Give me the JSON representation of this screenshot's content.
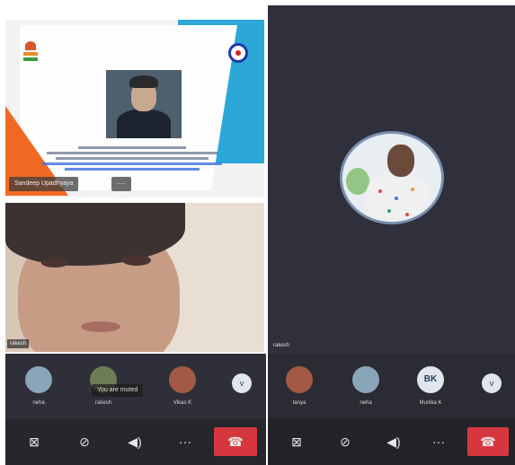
{
  "left": {
    "presenter": {
      "name": "Sandeep Upadhyaya",
      "more_label": "···"
    },
    "camera_label": "rakesh",
    "participants": [
      {
        "name": "neha"
      },
      {
        "name": "rakesh"
      },
      {
        "name": "Vikas K"
      }
    ],
    "toast": "You are muted",
    "overflow_label": "v",
    "controls": [
      "video-off",
      "mic-off",
      "speaker",
      "more",
      "hang-up"
    ]
  },
  "right": {
    "tile_label": "rakesh",
    "participants": [
      {
        "name": "tanya"
      },
      {
        "name": "neha"
      },
      {
        "name": "Munika K",
        "initials": "BK"
      }
    ],
    "overflow_label": "v",
    "controls": [
      "video-off",
      "mic-off",
      "speaker",
      "more",
      "hang-up"
    ]
  },
  "glyphs": {
    "video_off": "⊠",
    "mic_off": "⊘",
    "speaker": "◀)",
    "more": "···",
    "hangup": "☎"
  },
  "colors": {
    "hangup": "#d6373f",
    "panel": "#2f303b"
  }
}
